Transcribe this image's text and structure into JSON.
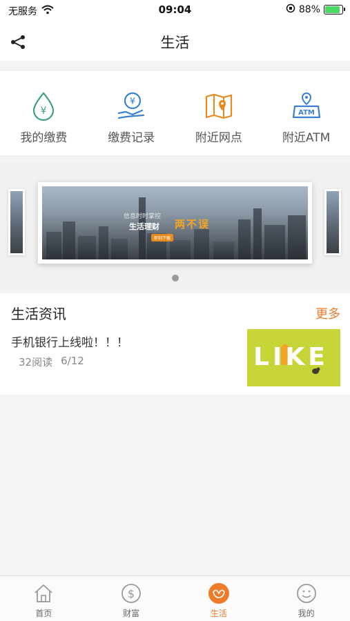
{
  "status_bar": {
    "carrier": "无服务",
    "time": "09:04",
    "battery_percent": "88%",
    "battery_level": 0.88
  },
  "nav": {
    "title": "生活",
    "share_icon": "share-icon"
  },
  "quick_actions": [
    {
      "label": "我的缴费",
      "icon": "payment-drop-icon",
      "color": "#3fa07a"
    },
    {
      "label": "缴费记录",
      "icon": "payment-record-icon",
      "color": "#3b7fd4"
    },
    {
      "label": "附近网点",
      "icon": "map-pin-icon",
      "color": "#e8891c"
    },
    {
      "label": "附近ATM",
      "icon": "atm-location-icon",
      "color": "#3b7fd4"
    }
  ],
  "banner": {
    "line1": "信息时时掌控",
    "line2": "生活理财",
    "highlight": "两不误",
    "button": "即刻下载"
  },
  "news": {
    "section_title": "生活资讯",
    "more_label": "更多",
    "items": [
      {
        "title": "手机银行上线啦！！！",
        "reads": "32阅读",
        "date": "6/12",
        "thumb_text": "LIKE"
      }
    ]
  },
  "tabs": [
    {
      "label": "首页",
      "icon": "home-icon",
      "active": false
    },
    {
      "label": "财富",
      "icon": "wealth-icon",
      "active": false
    },
    {
      "label": "生活",
      "icon": "life-icon",
      "active": true
    },
    {
      "label": "我的",
      "icon": "profile-icon",
      "active": false
    }
  ],
  "colors": {
    "accent": "#ee7b2a",
    "green": "#3fa07a",
    "blue": "#3b7fd4",
    "orange": "#e8891c"
  }
}
